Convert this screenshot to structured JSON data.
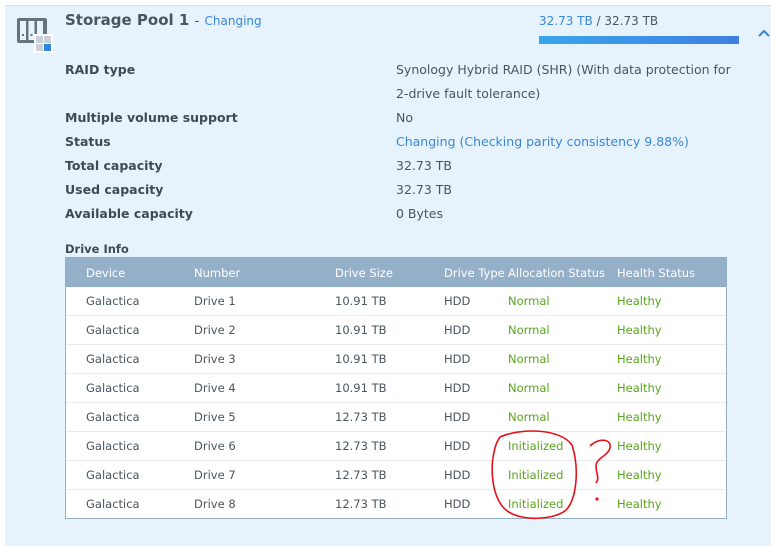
{
  "pool": {
    "title": "Storage Pool 1",
    "separator": "-",
    "state": "Changing",
    "usage_used": "32.73 TB",
    "usage_sep": " / ",
    "usage_total": "32.73 TB",
    "usage_fraction": 1.0,
    "icon": "storage-pool-icon",
    "collapse_icon": "chevron-up-icon"
  },
  "properties": [
    {
      "label": "RAID type",
      "value": "Synology Hybrid RAID (SHR) (With data protection for 2-drive fault tolerance)"
    },
    {
      "label": "Multiple volume support",
      "value": "No"
    },
    {
      "label": "Status",
      "value": "Changing (Checking parity consistency 9.88%)"
    },
    {
      "label": "Total capacity",
      "value": "32.73 TB"
    },
    {
      "label": "Used capacity",
      "value": "32.73 TB"
    },
    {
      "label": "Available capacity",
      "value": "0 Bytes"
    }
  ],
  "drive_info": {
    "title": "Drive Info",
    "columns": [
      "Device",
      "Number",
      "Drive Size",
      "Drive Type",
      "Allocation Status",
      "Health Status"
    ],
    "rows": [
      [
        "Galactica",
        "Drive 1",
        "10.91 TB",
        "HDD",
        "Normal",
        "Healthy"
      ],
      [
        "Galactica",
        "Drive 2",
        "10.91 TB",
        "HDD",
        "Normal",
        "Healthy"
      ],
      [
        "Galactica",
        "Drive 3",
        "10.91 TB",
        "HDD",
        "Normal",
        "Healthy"
      ],
      [
        "Galactica",
        "Drive 4",
        "10.91 TB",
        "HDD",
        "Normal",
        "Healthy"
      ],
      [
        "Galactica",
        "Drive 5",
        "12.73 TB",
        "HDD",
        "Normal",
        "Healthy"
      ],
      [
        "Galactica",
        "Drive 6",
        "12.73 TB",
        "HDD",
        "Initialized",
        "Healthy"
      ],
      [
        "Galactica",
        "Drive 7",
        "12.73 TB",
        "HDD",
        "Initialized",
        "Healthy"
      ],
      [
        "Galactica",
        "Drive 8",
        "12.73 TB",
        "HDD",
        "Initialized",
        "Healthy"
      ]
    ]
  },
  "colors": {
    "link": "#3a87d6",
    "status_green": "#5aa51f",
    "table_header": "#94b0c8",
    "panel_bg": "#e6f2fc",
    "annotation_red": "#e8101a"
  },
  "annotation": {
    "description": "red hand-drawn circle around Initialized cells with question mark"
  }
}
